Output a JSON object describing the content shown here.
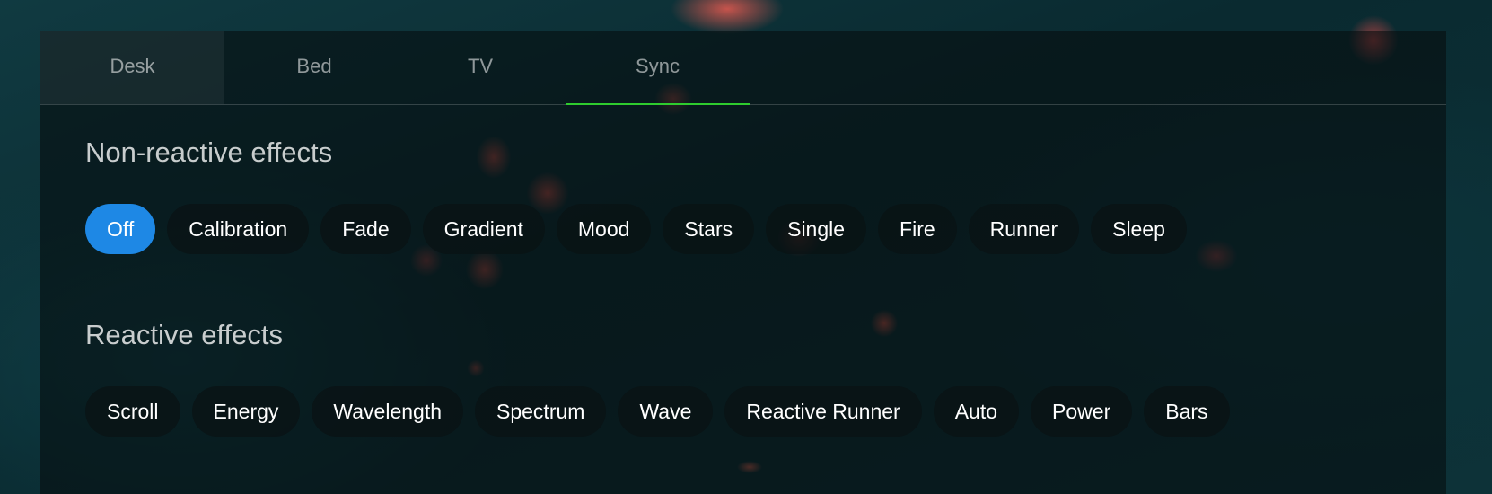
{
  "tabs": [
    {
      "label": "Desk"
    },
    {
      "label": "Bed"
    },
    {
      "label": "TV"
    },
    {
      "label": "Sync"
    }
  ],
  "active_tab": "Sync",
  "sections": [
    {
      "title": "Non-reactive effects",
      "effects": [
        "Off",
        "Calibration",
        "Fade",
        "Gradient",
        "Mood",
        "Stars",
        "Single",
        "Fire",
        "Runner",
        "Sleep"
      ]
    },
    {
      "title": "Reactive effects",
      "effects": [
        "Scroll",
        "Energy",
        "Wavelength",
        "Spectrum",
        "Wave",
        "Reactive Runner",
        "Auto",
        "Power",
        "Bars"
      ]
    }
  ],
  "selected_effect": "Off",
  "colors": {
    "active_tab_indicator": "#2ecc2e",
    "selected_chip": "#1e88e5"
  }
}
